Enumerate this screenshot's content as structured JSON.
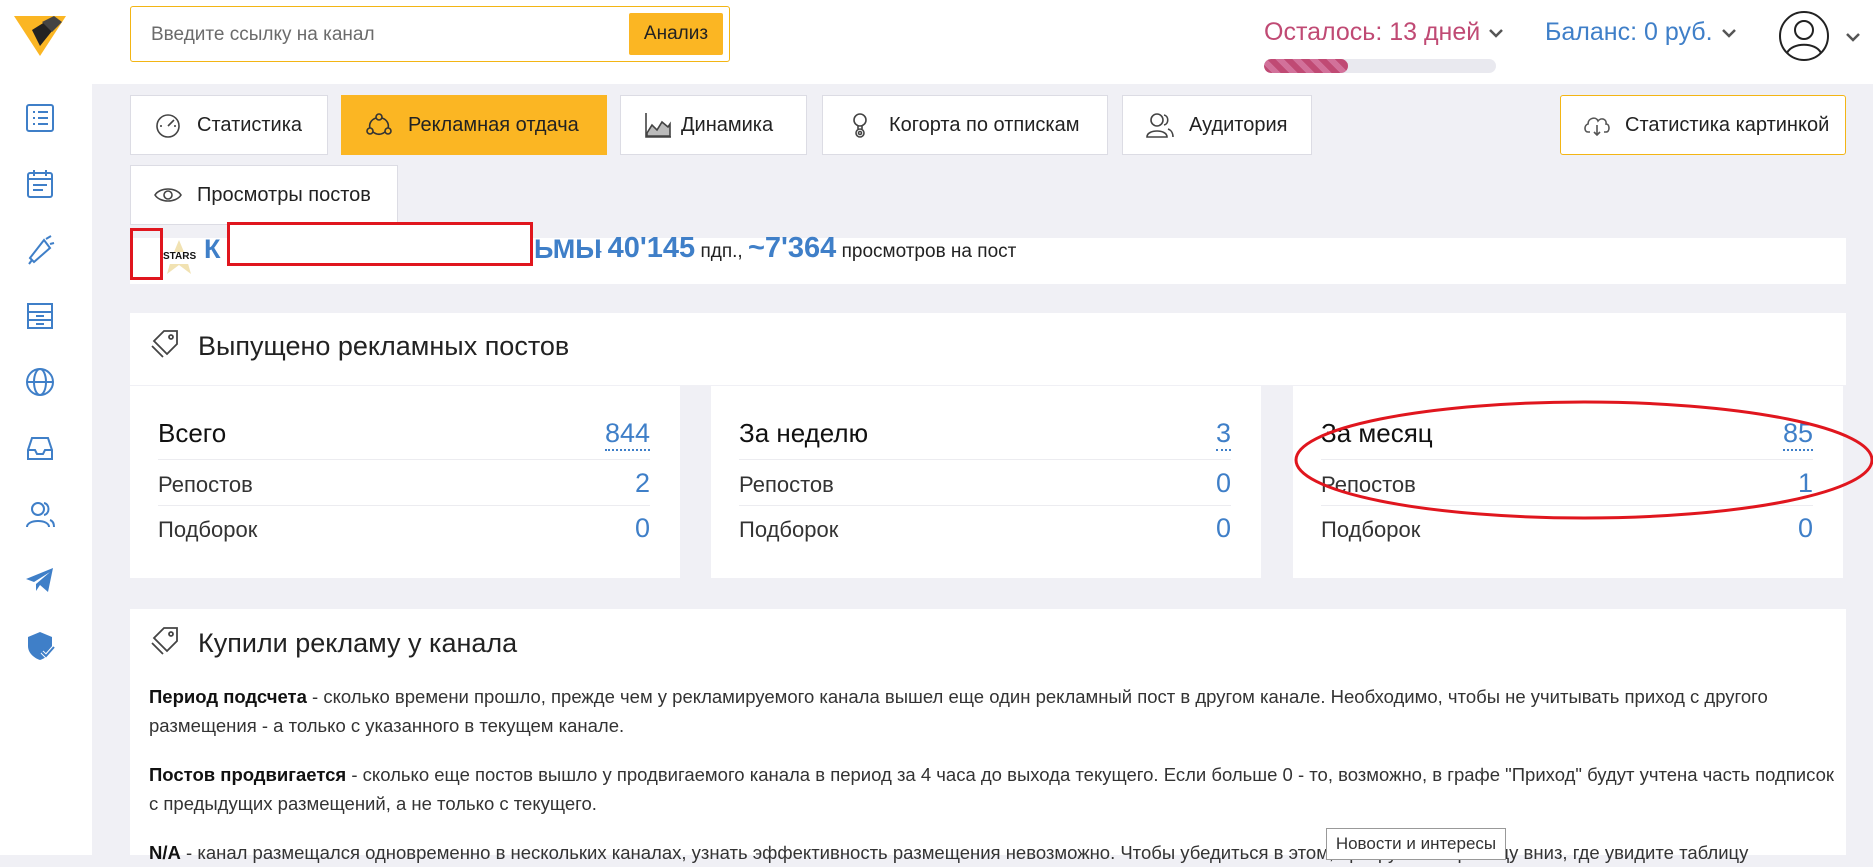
{
  "header": {
    "search_placeholder": "Введите ссылку на канал",
    "analyze_label": "Анализ",
    "remaining": "Осталось: 13 дней",
    "remaining_progress": 0.36,
    "balance": "Баланс: 0 руб."
  },
  "sidebar": {
    "icons": [
      "list-icon",
      "planner-icon",
      "megaphone-icon",
      "archive-icon",
      "globe-icon",
      "inbox-icon",
      "users-icon",
      "telegram-icon",
      "shield-check-icon"
    ]
  },
  "tabs": [
    {
      "label": "Статистика",
      "icon": "speedometer-icon"
    },
    {
      "label": "Рекламная отдача",
      "icon": "network-icon",
      "active": true
    },
    {
      "label": "Динамика",
      "icon": "area-chart-icon"
    },
    {
      "label": "Когорта по отпискам",
      "icon": "bulb-gear-icon"
    },
    {
      "label": "Аудитория",
      "icon": "users-icon"
    },
    {
      "label": "Просмотры постов",
      "icon": "eye-icon"
    }
  ],
  "picture_button": "Статистика картинкой",
  "channel": {
    "name_start": "К",
    "name_end": "ЬМЫ",
    "dash": "-",
    "subscribers": "40'145",
    "subscribers_unit": "пдп.,",
    "views": "~7'364",
    "views_unit": "просмотров на пост",
    "avatar_text": "STARS"
  },
  "released": {
    "title": "Выпущено рекламных постов",
    "cards": [
      {
        "title": "Всего",
        "total": "844",
        "reposts_label": "Репостов",
        "reposts": "2",
        "collections_label": "Подборок",
        "collections": "0"
      },
      {
        "title": "За неделю",
        "total": "3",
        "reposts_label": "Репостов",
        "reposts": "0",
        "collections_label": "Подборок",
        "collections": "0"
      },
      {
        "title": "За месяц",
        "total": "85",
        "reposts_label": "Репостов",
        "reposts": "1",
        "collections_label": "Подборок",
        "collections": "0"
      }
    ]
  },
  "bought": {
    "title": "Купили рекламу у канала",
    "p1_term": "Период подсчета",
    "p1_text": " - сколько времени прошло, прежде чем у рекламируемого канала вышел еще один рекламный пост в другом канале. Необходимо, чтобы не учитывать приход с другого размещения - а только с указанного в текущем канале.",
    "p2_term": "Постов продвигается",
    "p2_text": " - сколько еще постов вышло у продвигаемого канала в период за 4 часа до выхода текущего. Если больше 0 - то, возможно, в графе \"Приход\" будут учтена часть подписок с предыдущих размещений, а не только с текущего.",
    "p3_term": "N/A",
    "p3_text": " - канал размещался одновременно в нескольких каналах, узнать эффективность размещения невозможно. Чтобы убедиться в этом, прокрутите страницу вниз, где увидите таблицу"
  },
  "tooltip": "Новости и интересы",
  "colors": {
    "accent": "#fbb623",
    "link": "#3f7fc8",
    "remaining": "#c04a74",
    "annotation": "#e0161e"
  }
}
